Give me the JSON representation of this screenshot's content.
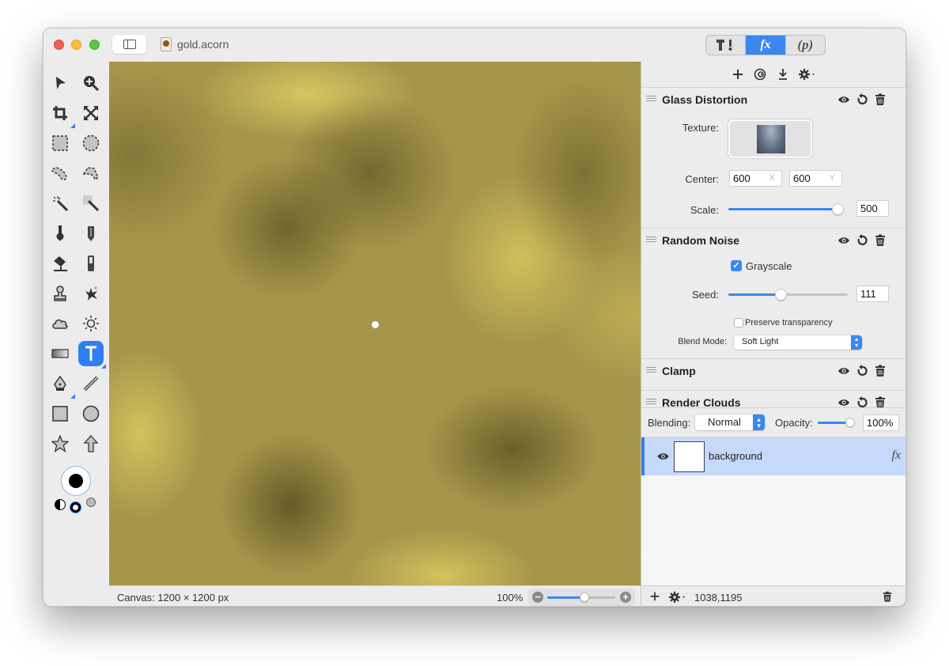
{
  "window": {
    "title": "gold.acorn",
    "traffic_lights": [
      "close",
      "minimize",
      "zoom"
    ]
  },
  "toolbar": {
    "sidebar_toggle_icon": "sidebar-icon",
    "segmented": [
      {
        "label": "T!",
        "icon": "tools-icon",
        "active": false
      },
      {
        "label": "fx",
        "icon": "fx-icon",
        "active": true
      },
      {
        "label": "(p)",
        "icon": "properties-icon",
        "active": false
      }
    ],
    "accent_color": "#3a87f2"
  },
  "tools": [
    {
      "name": "move",
      "icon": "arrow-icon"
    },
    {
      "name": "zoom",
      "icon": "zoom-icon"
    },
    {
      "name": "crop",
      "icon": "crop-icon"
    },
    {
      "name": "transform",
      "icon": "expand-icon"
    },
    {
      "name": "rect-select",
      "icon": "rect-select-icon"
    },
    {
      "name": "ellipse-select",
      "icon": "ellipse-select-icon"
    },
    {
      "name": "lasso",
      "icon": "lasso-icon"
    },
    {
      "name": "polygon-lasso",
      "icon": "polygon-lasso-icon"
    },
    {
      "name": "magic-wand",
      "icon": "magic-wand-icon"
    },
    {
      "name": "instant-alpha",
      "icon": "instant-alpha-icon"
    },
    {
      "name": "brush",
      "icon": "brush-icon"
    },
    {
      "name": "pencil",
      "icon": "pencil-icon"
    },
    {
      "name": "paint-bucket",
      "icon": "paint-bucket-icon"
    },
    {
      "name": "eraser",
      "icon": "eraser-icon"
    },
    {
      "name": "clone",
      "icon": "clone-stamp-icon"
    },
    {
      "name": "smudge",
      "icon": "splatter-icon"
    },
    {
      "name": "burn",
      "icon": "cloud-icon"
    },
    {
      "name": "dodge",
      "icon": "sun-icon"
    },
    {
      "name": "gradient",
      "icon": "gradient-icon"
    },
    {
      "name": "text",
      "icon": "text-icon",
      "active": true
    },
    {
      "name": "bezier",
      "icon": "pen-icon"
    },
    {
      "name": "line",
      "icon": "line-icon"
    },
    {
      "name": "rectangle",
      "icon": "rectangle-icon"
    },
    {
      "name": "oval",
      "icon": "oval-icon"
    },
    {
      "name": "star",
      "icon": "star-icon"
    },
    {
      "name": "arrow",
      "icon": "arrow-up-icon"
    }
  ],
  "color_well": {
    "primary": "#000000"
  },
  "canvas": {
    "size_label": "Canvas: 1200 × 1200 px",
    "zoom_label": "100%",
    "zoom_fraction": 0.55
  },
  "fx_panel": {
    "toolbar_icons": [
      "plus-icon",
      "filter-icon",
      "download-icon",
      "gear-icon"
    ],
    "filters": [
      {
        "title": "Glass Distortion",
        "texture_label": "Texture:",
        "center_label": "Center:",
        "center_x": "600",
        "center_y": "600",
        "x_axis": "X",
        "y_axis": "Y",
        "scale_label": "Scale:",
        "scale_value": "500",
        "scale_fraction": 1.0
      },
      {
        "title": "Random Noise",
        "grayscale_label": "Grayscale",
        "grayscale_checked": true,
        "seed_label": "Seed:",
        "seed_value": "111",
        "seed_fraction": 0.44,
        "preserve_label": "Preserve transparency",
        "preserve_checked": false,
        "blend_mode_label": "Blend Mode:",
        "blend_mode_value": "Soft Light"
      },
      {
        "title": "Clamp"
      },
      {
        "title": "Render Clouds"
      }
    ]
  },
  "layer_controls": {
    "blending_label": "Blending:",
    "blending_value": "Normal",
    "opacity_label": "Opacity:",
    "opacity_value": "100%",
    "opacity_fraction": 1.0
  },
  "layers": [
    {
      "name": "background",
      "visible": true,
      "selected": true,
      "fx": "fx"
    }
  ],
  "bottom_bar": {
    "coords": "1038,1195"
  }
}
